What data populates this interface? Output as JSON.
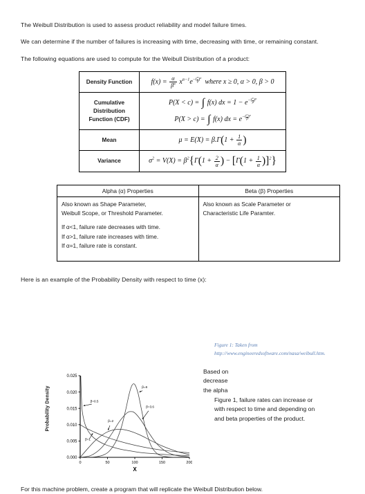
{
  "document": {
    "intro_paragraphs": [
      "The Weibull Distribution is used to assess product reliability and model failure times.",
      "We can determine if the number of failures is increasing with time, decreasing with time, or remaining constant.",
      "The following equations are used to compute for the Weibull Distribution of a product:"
    ],
    "example_lead": "Here is an example of the Probability Density with respect to time (x):",
    "closing_line": "For this machine problem, create a program that will replicate the Weibull Distribution below."
  },
  "equation_table": {
    "rows": [
      {
        "label": "Density Function",
        "equations": [
          "f(x) = (α/β^α) x^(α−1) e^(−(x/β)^α)  where x ≥ 0, α > 0, β > 0"
        ]
      },
      {
        "label": "Cumulative Distribution Function (CDF)",
        "equations": [
          "P(X < c) = ∫ f(x) dx = 1 − e^(−(c/β)^α)",
          "P(X > c) = ∫ f(x) dx = e^(−(c/β)^α)"
        ]
      },
      {
        "label": "Mean",
        "equations": [
          "μ = E(X) = β . Γ(1 + 1/α)"
        ]
      },
      {
        "label": "Variance",
        "equations": [
          "σ² = V(X) = β² { Γ(1 + 2/α) − [Γ(1 + 1/α)]² }"
        ]
      }
    ]
  },
  "properties_table": {
    "headers": [
      "Alpha (α) Properties",
      "Beta (β) Properties"
    ],
    "alpha": {
      "line1": "Also known as Shape Parameter,",
      "line2": "Weibull Scope, or Threshold Parameter.",
      "line3": "If α<1, failure rate decreases with time.",
      "line4": "If α>1, failure rate increases with time.",
      "line5": "If α=1, failure rate is constant."
    },
    "beta": {
      "line1": "Also known as Scale Parameter or",
      "line2": "Characteristic Life Paramter."
    }
  },
  "figure": {
    "caption_line1": "Figure 1: Taken from",
    "caption_line2": "http://www.engineeredsoftware.com/nasa/weibull.htm."
  },
  "wrap_text": {
    "left_col_line1": "Based on",
    "left_col_line2": "decrease",
    "left_col_line3": "the alpha",
    "right_col_line1": "Figure 1, failure rates can increase or",
    "right_col_line2": "with respect to time and depending on",
    "right_col_line3": "and beta properties of the product."
  },
  "chart_data": {
    "type": "line",
    "title": "",
    "xlabel": "X",
    "ylabel": "Probability Density",
    "xlim": [
      0,
      200
    ],
    "ylim": [
      0,
      0.025
    ],
    "xticks": [
      0,
      50,
      100,
      150,
      200
    ],
    "yticks": [
      0.0,
      0.005,
      0.01,
      0.015,
      0.02,
      0.025
    ],
    "ytick_labels": [
      "0.000",
      "0.005",
      "0.010",
      "0.015",
      "0.020",
      "0.025"
    ],
    "xtick_labels": [
      "0",
      "50",
      "100",
      "150",
      "200"
    ],
    "grid": false,
    "legend": "inline-annotations",
    "scale_beta": 100,
    "series": [
      {
        "name": "β=0.5",
        "shape": 0.5,
        "label": "β=0.5",
        "label_x": 26,
        "label_y": 0.0168,
        "points_x": [
          1,
          3,
          6,
          10,
          16,
          24,
          34,
          46,
          60,
          76,
          94,
          114,
          136,
          160,
          186,
          200
        ],
        "points_y": [
          0.025,
          0.0156,
          0.012,
          0.0096,
          0.0077,
          0.0061,
          0.0049,
          0.0039,
          0.0031,
          0.0024,
          0.0019,
          0.0014,
          0.0011,
          0.0008,
          0.0006,
          0.0005
        ]
      },
      {
        "name": "β=1",
        "shape": 1.0,
        "label": "β=1",
        "label_x": 14,
        "label_y": 0.0052,
        "points_x": [
          0,
          10,
          25,
          45,
          70,
          100,
          130,
          160,
          185,
          200
        ],
        "points_y": [
          0.01,
          0.009,
          0.0078,
          0.0064,
          0.005,
          0.0037,
          0.0027,
          0.002,
          0.0016,
          0.0014
        ]
      },
      {
        "name": "β=2",
        "shape": 2.0,
        "label": "β=2",
        "label_x": 56,
        "label_y": 0.0108,
        "points_x": [
          0,
          15,
          30,
          50,
          71,
          90,
          110,
          130,
          150,
          170,
          190,
          200
        ],
        "points_y": [
          0.0,
          0.0029,
          0.0055,
          0.0078,
          0.0086,
          0.0081,
          0.0068,
          0.0051,
          0.0035,
          0.0022,
          0.0012,
          0.0009
        ]
      },
      {
        "name": "β=3.6",
        "shape": 3.6,
        "label": "β=3.6",
        "label_x": 128,
        "label_y": 0.0152,
        "points_x": [
          0,
          20,
          40,
          58,
          72,
          85,
          92,
          100,
          112,
          125,
          140,
          158,
          175,
          200
        ],
        "points_y": [
          0.0,
          0.0006,
          0.0031,
          0.0073,
          0.011,
          0.0135,
          0.014,
          0.0136,
          0.0112,
          0.0077,
          0.0042,
          0.0017,
          0.0006,
          0.0001
        ]
      },
      {
        "name": "β=6",
        "shape": 6.0,
        "label": "β=6",
        "label_x": 118,
        "label_y": 0.0212,
        "points_x": [
          0,
          30,
          50,
          65,
          75,
          83,
          90,
          95,
          100,
          106,
          112,
          120,
          130,
          142,
          158,
          180,
          200
        ],
        "points_y": [
          0.0,
          0.0002,
          0.0014,
          0.0047,
          0.009,
          0.0143,
          0.0196,
          0.0221,
          0.0223,
          0.0196,
          0.0148,
          0.0086,
          0.0035,
          0.001,
          0.0002,
          0.0,
          0.0
        ]
      }
    ]
  }
}
